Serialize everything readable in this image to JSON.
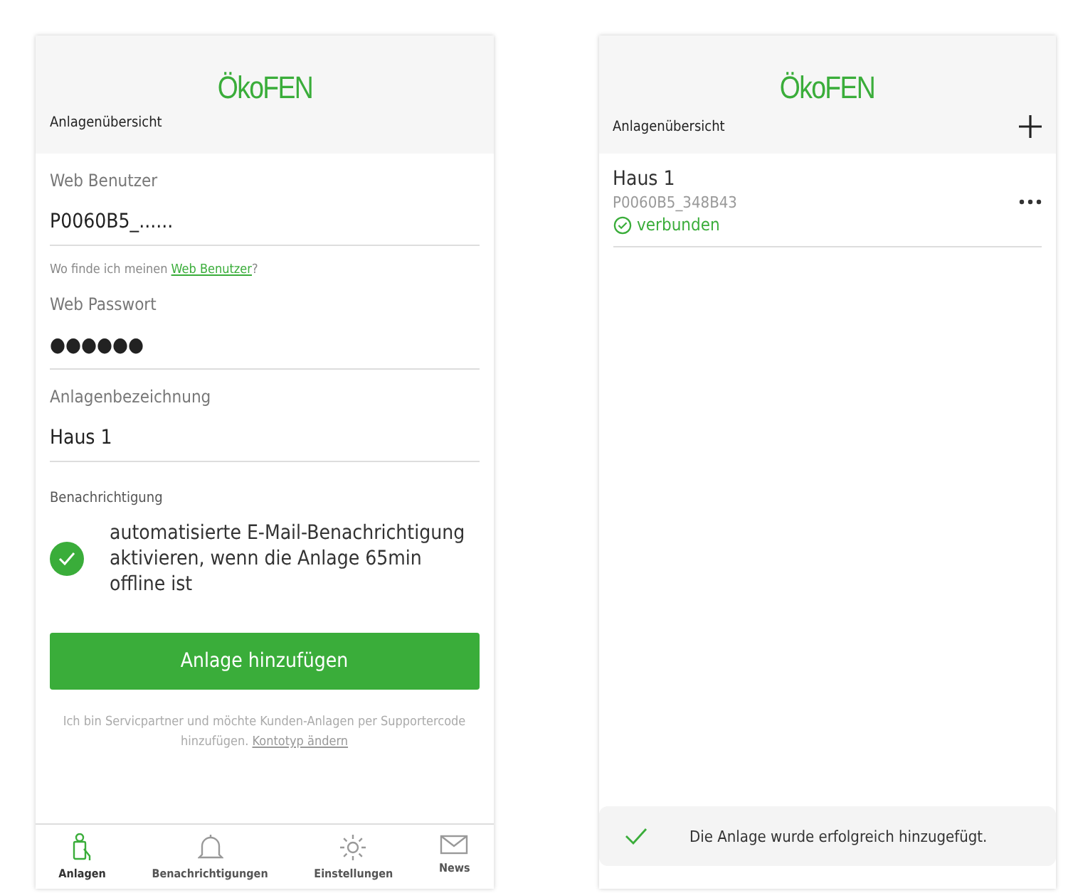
{
  "screens": [
    {
      "kind": "form",
      "logo": "ÖkoFEN",
      "title": "Anlagenübersicht",
      "fields": [
        {
          "label": "Web Benutzer",
          "value": "P0060B5_......",
          "hint": "Wo finde ich meinen ",
          "hint_link": "Web Benutzer",
          "hint_end": "?"
        },
        {
          "label": "Web Passwort",
          "value": "●●●●●●"
        },
        {
          "label": "Anlagenbezeichnung",
          "value": "Haus 1"
        }
      ],
      "notification": {
        "label": "Benachrichtigung",
        "text": "automatisierte E-Mail-Benachrichtigung aktivieren, wenn die Anlage 65min offline ist",
        "checked": true
      },
      "button": "Anlage hinzufügen",
      "footnote": "Ich bin Servicpartner und möchte Kunden-Anlagen per Supportercode hinzufügen. ",
      "footnote_link": "Kontotyp ändern",
      "tabs": [
        {
          "label": "Anlagen",
          "kind": "plant",
          "selected": true
        },
        {
          "label": "Benachrichtigungen",
          "kind": "bell",
          "selected": false
        },
        {
          "label": "Einstellungen",
          "kind": "gear",
          "selected": false
        },
        {
          "label": "News",
          "kind": "mail",
          "selected": false
        }
      ]
    },
    {
      "kind": "list",
      "logo": "ÖkoFEN",
      "title": "Anlagenübersicht",
      "items": [
        {
          "name": "Haus 1",
          "id": "P0060B5_348B43",
          "status": "verbunden",
          "connected": true
        }
      ],
      "toast": "Die Anlage wurde erfolgreich hinzugefügt."
    }
  ]
}
